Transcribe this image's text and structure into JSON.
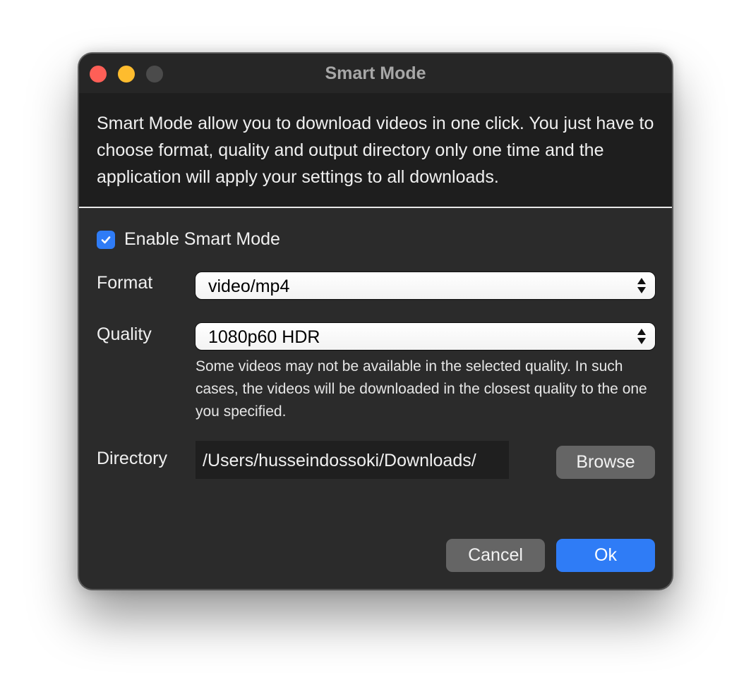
{
  "window": {
    "title": "Smart Mode"
  },
  "intro": {
    "text": "Smart Mode allow you to download videos in one click. You just have to choose format, quality and output directory only one time and the application will apply your settings to all downloads."
  },
  "smart_mode": {
    "enable_label": "Enable Smart Mode",
    "enabled": true
  },
  "format": {
    "label": "Format",
    "value": "video/mp4"
  },
  "quality": {
    "label": "Quality",
    "value": "1080p60 HDR",
    "hint": "Some videos may not be available in the selected quality. In such cases, the videos will be downloaded in the closest quality to the one you specified."
  },
  "directory": {
    "label": "Directory",
    "value": "/Users/husseindossoki/Downloads/",
    "browse_label": "Browse"
  },
  "actions": {
    "cancel_label": "Cancel",
    "ok_label": "Ok"
  },
  "colors": {
    "accent": "#2f7cf6",
    "close": "#fe5f57",
    "minimize": "#febc2e",
    "zoom_disabled": "#4b4b4b"
  }
}
